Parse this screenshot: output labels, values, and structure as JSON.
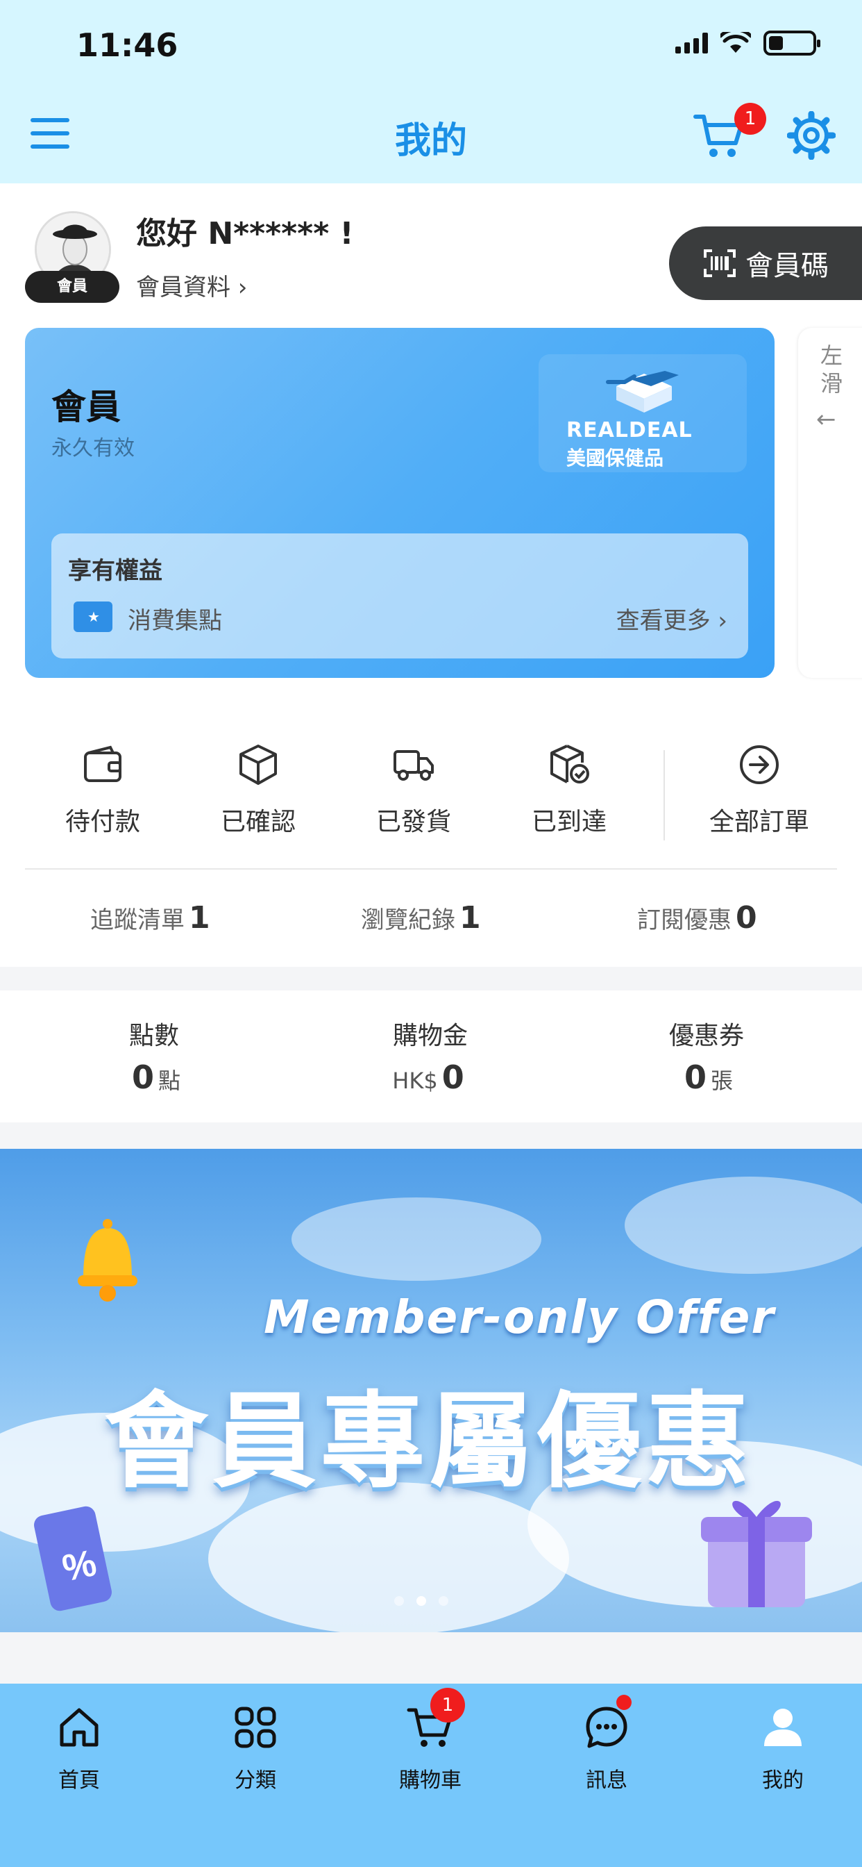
{
  "status_bar": {
    "time": "11:46"
  },
  "nav": {
    "title": "我的",
    "cart_badge": "1"
  },
  "profile": {
    "greeting": "您好 N****** !",
    "profile_link": "會員資料 ›",
    "member_tag": "會員",
    "member_code_label": "會員碼"
  },
  "member_card": {
    "title": "會員",
    "validity": "永久有效",
    "brand_name": "REALDEAL",
    "brand_sub": "美國保健品",
    "benefits_title": "享有權益",
    "benefit_item": "消費集點",
    "view_more": "查看更多 ›",
    "peek_text": "左滑",
    "peek_arrow": "←"
  },
  "orders": {
    "items": [
      {
        "label": "待付款",
        "icon": "wallet-icon"
      },
      {
        "label": "已確認",
        "icon": "box-icon"
      },
      {
        "label": "已發貨",
        "icon": "truck-icon"
      },
      {
        "label": "已到達",
        "icon": "box-check-icon"
      },
      {
        "label": "全部訂單",
        "icon": "arrow-circle-icon"
      }
    ],
    "stats": [
      {
        "label": "追蹤清單",
        "value": "1"
      },
      {
        "label": "瀏覽紀錄",
        "value": "1"
      },
      {
        "label": "訂閱優惠",
        "value": "0"
      }
    ]
  },
  "assets": [
    {
      "title": "點數",
      "prefix": "",
      "value": "0",
      "suffix": "點"
    },
    {
      "title": "購物金",
      "prefix": "HK$",
      "value": "0",
      "suffix": ""
    },
    {
      "title": "優惠券",
      "prefix": "",
      "value": "0",
      "suffix": "張"
    }
  ],
  "banner": {
    "en": "Member-only Offer",
    "zh": "會員專屬優惠",
    "active_slide": 2,
    "slide_count": 3
  },
  "tabbar": {
    "items": [
      {
        "label": "首頁",
        "icon": "home-icon"
      },
      {
        "label": "分類",
        "icon": "grid-icon"
      },
      {
        "label": "購物車",
        "icon": "cart-icon"
      },
      {
        "label": "訊息",
        "icon": "chat-icon"
      },
      {
        "label": "我的",
        "icon": "user-icon"
      }
    ],
    "cart_badge": "1"
  },
  "colors": {
    "accent": "#1a8fe6",
    "badge": "#f01d1d",
    "tabbar": "#76c7fb",
    "header_bg": "#d6f6ff"
  }
}
